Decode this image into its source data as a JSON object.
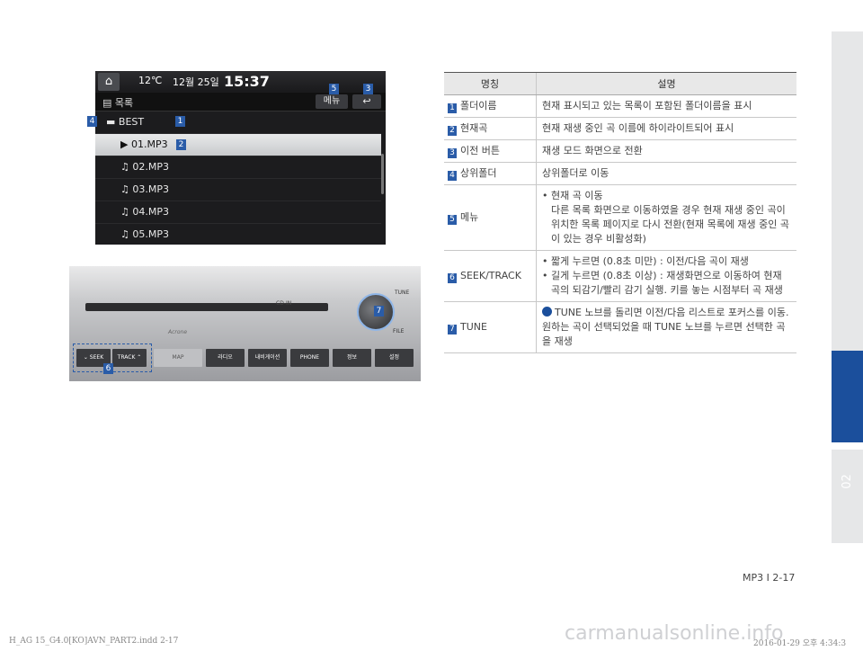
{
  "screen": {
    "temp": "12℃",
    "date": "12월 25일",
    "time": "15:37",
    "folder_label": "목록",
    "menu_label": "메뉴",
    "back_icon": "back-arrow-icon",
    "current_folder": "BEST",
    "files": [
      "01.MP3",
      "02.MP3",
      "03.MP3",
      "04.MP3",
      "05.MP3"
    ],
    "selected_index": 0
  },
  "callouts": [
    "1",
    "2",
    "3",
    "4",
    "5",
    "6",
    "7"
  ],
  "panel": {
    "cd_in": "CD-IN",
    "tune": "TUNE",
    "file": "FILE",
    "seek": "SEEK",
    "track": "TRACK",
    "brand": "Acrone",
    "map": "MAP",
    "buttons": [
      "라디오",
      "내비게이션",
      "PHONE",
      "정보",
      "설정"
    ]
  },
  "table": {
    "headers": [
      "명칭",
      "설명"
    ],
    "rows": [
      {
        "num": "1",
        "name": "폴더이름",
        "desc": [
          "현재 표시되고 있는 목록이 포함된 폴더이름을 표시"
        ]
      },
      {
        "num": "2",
        "name": "현재곡",
        "desc": [
          "현재 재생 중인 곡 이름에 하이라이트되어 표시"
        ]
      },
      {
        "num": "3",
        "name": "이전 버튼",
        "desc": [
          "재생 모드 화면으로 전환"
        ]
      },
      {
        "num": "4",
        "name": "상위폴더",
        "desc": [
          "상위폴더로 이동"
        ]
      },
      {
        "num": "5",
        "name": "메뉴",
        "desc": [
          "• 현재 곡 이동",
          "다른 목록 화면으로 이동하였을 경우 현재 재생 중인 곡이 위치한 목록 페이지로 다시 전환(현재 목록에 재생 중인 곡이 있는 경우 비활성화)"
        ]
      },
      {
        "num": "6",
        "name": "SEEK/TRACK",
        "desc": [
          "• 짧게 누르면 (0.8초 미만) : 이전/다음 곡이 재생",
          "• 길게 누르면 (0.8초 이상) : 재생화면으로 이동하여 현재 곡의 되감기/빨리 감기 실행. 키를 놓는 시점부터 곡 재생"
        ]
      },
      {
        "num": "7",
        "name": "TUNE",
        "desc": [
          "TUNE 노브를 돌리면 이전/다음 리스트로 포커스를 이동. 원하는 곡이 선택되었을 때 TUNE 노브를 누르면 선택한 곡을 재생"
        ]
      }
    ]
  },
  "sidebar": {
    "chapter": "02"
  },
  "footer": {
    "page": "MP3 I 2-17",
    "file": "H_AG 15_G4.0[KO]AVN_PART2.indd   2-17",
    "date": "2016-01-29   오후 4:34:3",
    "watermark": "carmanualsonline.info"
  }
}
